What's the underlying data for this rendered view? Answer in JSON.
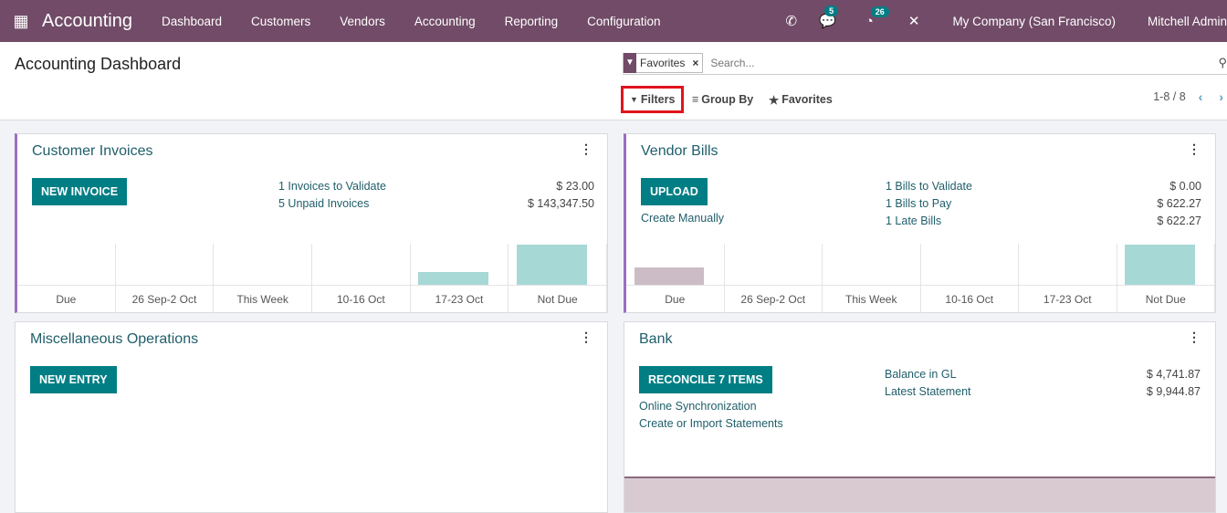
{
  "navbar": {
    "app": "Accounting",
    "menu": [
      "Dashboard",
      "Customers",
      "Vendors",
      "Accounting",
      "Reporting",
      "Configuration"
    ],
    "messages_count": "5",
    "activities_count": "26",
    "company": "My Company (San Francisco)",
    "user": "Mitchell Admin",
    "color": "#714B67"
  },
  "control": {
    "title": "Accounting Dashboard",
    "facet": "Favorites",
    "search_placeholder": "Search...",
    "filters": "Filters",
    "group_by": "Group By",
    "favorites": "Favorites",
    "pager": "1-8 / 8"
  },
  "cards": {
    "customer": {
      "title": "Customer Invoices",
      "button": "NEW INVOICE",
      "stats": [
        {
          "label": "1 Invoices to Validate",
          "value": "$ 23.00"
        },
        {
          "label": "5 Unpaid Invoices",
          "value": "$ 143,347.50"
        }
      ]
    },
    "vendor": {
      "title": "Vendor Bills",
      "button": "UPLOAD",
      "link": "Create Manually",
      "stats": [
        {
          "label": "1 Bills to Validate",
          "value": "$ 0.00"
        },
        {
          "label": "1 Bills to Pay",
          "value": "$ 622.27"
        },
        {
          "label": "1 Late Bills",
          "value": "$ 622.27"
        }
      ]
    },
    "misc": {
      "title": "Miscellaneous Operations",
      "button": "NEW ENTRY"
    },
    "bank": {
      "title": "Bank",
      "button": "RECONCILE 7 ITEMS",
      "links": [
        "Online Synchronization",
        "Create or Import Statements"
      ],
      "stats": [
        {
          "label": "Balance in GL",
          "value": "$ 4,741.87"
        },
        {
          "label": "Latest Statement",
          "value": "$ 9,944.87"
        }
      ]
    }
  },
  "chart_data": [
    {
      "type": "bar",
      "chart": "customer-invoices",
      "categories": [
        "Due",
        "26 Sep-2 Oct",
        "This Week",
        "10-16 Oct",
        "17-23 Oct",
        "Not Due"
      ],
      "values": [
        0,
        0,
        0,
        0,
        0.32,
        1
      ],
      "colors": [
        "#a6d8d6"
      ]
    },
    {
      "type": "bar",
      "chart": "vendor-bills",
      "categories": [
        "Due",
        "26 Sep-2 Oct",
        "This Week",
        "10-16 Oct",
        "17-23 Oct",
        "Not Due"
      ],
      "values": [
        0.43,
        0,
        0,
        0,
        0,
        1
      ],
      "colors": [
        "#cbbcc6",
        "#a6d8d6"
      ]
    }
  ]
}
